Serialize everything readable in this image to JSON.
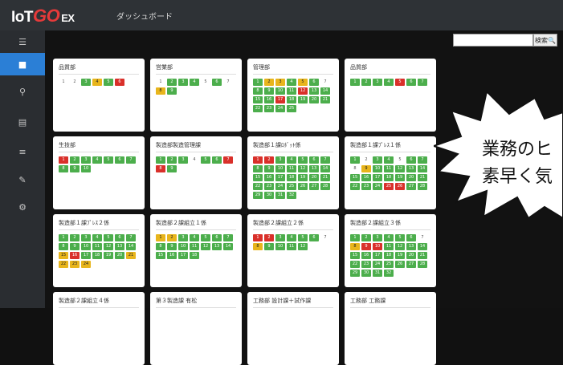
{
  "header": {
    "logo_main": "IoT",
    "logo_go": "GO",
    "logo_ex": "EX",
    "title": "ダッシュボード"
  },
  "sidebar": {
    "items": [
      {
        "icon": "menu-icon",
        "glyph": "☰"
      },
      {
        "icon": "dashboard-icon",
        "glyph": "■",
        "active": true
      },
      {
        "icon": "search-icon",
        "glyph": "⚲"
      },
      {
        "icon": "calendar-icon",
        "glyph": "▤"
      },
      {
        "icon": "list-icon",
        "glyph": "≡"
      },
      {
        "icon": "edit-icon",
        "glyph": "✎"
      },
      {
        "icon": "settings-icon",
        "glyph": "⚙"
      }
    ]
  },
  "search": {
    "value": "",
    "button_label": "検索🔍"
  },
  "colors": {
    "green": "#4cae4c",
    "yellow": "#e8b51c",
    "red": "#d9302a",
    "accent": "#2b7fd6"
  },
  "cards": [
    {
      "title": "品質部",
      "chips": [
        [
          "1",
          "w"
        ],
        [
          "2",
          "w"
        ],
        [
          "3",
          "g"
        ],
        [
          "4",
          "y"
        ],
        [
          "5",
          "g"
        ],
        [
          "6",
          "r"
        ]
      ]
    },
    {
      "title": "営業部",
      "chips": [
        [
          "1",
          "w"
        ],
        [
          "2",
          "g"
        ],
        [
          "3",
          "g"
        ],
        [
          "4",
          "g"
        ],
        [
          "5",
          "w"
        ],
        [
          "6",
          "g"
        ],
        [
          "7",
          "w"
        ],
        [
          "8",
          "y"
        ],
        [
          "9",
          "g"
        ]
      ]
    },
    {
      "title": "管理部",
      "chips": [
        [
          "1",
          "g"
        ],
        [
          "2",
          "y"
        ],
        [
          "3",
          "y"
        ],
        [
          "4",
          "g"
        ],
        [
          "5",
          "y"
        ],
        [
          "6",
          "g"
        ],
        [
          "7",
          "w"
        ],
        [
          "8",
          "g"
        ],
        [
          "9",
          "g"
        ],
        [
          "10",
          "g"
        ],
        [
          "11",
          "g"
        ],
        [
          "12",
          "r"
        ],
        [
          "13",
          "g"
        ],
        [
          "14",
          "g"
        ],
        [
          "15",
          "g"
        ],
        [
          "16",
          "g"
        ],
        [
          "17",
          "r"
        ],
        [
          "18",
          "g"
        ],
        [
          "19",
          "g"
        ],
        [
          "20",
          "g"
        ],
        [
          "21",
          "g"
        ],
        [
          "22",
          "g"
        ],
        [
          "23",
          "g"
        ],
        [
          "24",
          "g"
        ],
        [
          "25",
          "g"
        ]
      ]
    },
    {
      "title": "品質部",
      "chips": [
        [
          "1",
          "g"
        ],
        [
          "2",
          "g"
        ],
        [
          "3",
          "g"
        ],
        [
          "4",
          "g"
        ],
        [
          "5",
          "r"
        ],
        [
          "6",
          "g"
        ],
        [
          "7",
          "g"
        ]
      ]
    },
    {
      "title": "生技部",
      "chips": [
        [
          "1",
          "r"
        ],
        [
          "2",
          "g"
        ],
        [
          "3",
          "g"
        ],
        [
          "4",
          "g"
        ],
        [
          "5",
          "g"
        ],
        [
          "6",
          "g"
        ],
        [
          "7",
          "g"
        ],
        [
          "8",
          "g"
        ],
        [
          "9",
          "g"
        ],
        [
          "10",
          "g"
        ]
      ]
    },
    {
      "title": "製造部製造管理課",
      "chips": [
        [
          "1",
          "g"
        ],
        [
          "2",
          "g"
        ],
        [
          "3",
          "g"
        ],
        [
          "4",
          "w"
        ],
        [
          "5",
          "g"
        ],
        [
          "6",
          "g"
        ],
        [
          "7",
          "r"
        ],
        [
          "8",
          "r"
        ],
        [
          "9",
          "g"
        ]
      ]
    },
    {
      "title": "製造部１課ﾛﾎﾞｯﾄ係",
      "chips": [
        [
          "1",
          "r"
        ],
        [
          "2",
          "r"
        ],
        [
          "3",
          "g"
        ],
        [
          "4",
          "g"
        ],
        [
          "5",
          "g"
        ],
        [
          "6",
          "g"
        ],
        [
          "7",
          "g"
        ],
        [
          "8",
          "g"
        ],
        [
          "9",
          "g"
        ],
        [
          "10",
          "g"
        ],
        [
          "11",
          "g"
        ],
        [
          "12",
          "g"
        ],
        [
          "13",
          "g"
        ],
        [
          "14",
          "g"
        ],
        [
          "15",
          "g"
        ],
        [
          "16",
          "g"
        ],
        [
          "17",
          "g"
        ],
        [
          "18",
          "g"
        ],
        [
          "19",
          "g"
        ],
        [
          "20",
          "g"
        ],
        [
          "21",
          "g"
        ],
        [
          "22",
          "g"
        ],
        [
          "23",
          "g"
        ],
        [
          "24",
          "g"
        ],
        [
          "25",
          "g"
        ],
        [
          "26",
          "g"
        ],
        [
          "27",
          "g"
        ],
        [
          "28",
          "g"
        ],
        [
          "29",
          "g"
        ],
        [
          "30",
          "g"
        ],
        [
          "31",
          "g"
        ],
        [
          "32",
          "g"
        ]
      ]
    },
    {
      "title": "製造部１課ﾌﾟﾚｽ１係",
      "chips": [
        [
          "1",
          "g"
        ],
        [
          "2",
          "w"
        ],
        [
          "3",
          "g"
        ],
        [
          "4",
          "g"
        ],
        [
          "5",
          "w"
        ],
        [
          "6",
          "g"
        ],
        [
          "7",
          "g"
        ],
        [
          "8",
          "w"
        ],
        [
          "9",
          "y"
        ],
        [
          "10",
          "g"
        ],
        [
          "11",
          "g"
        ],
        [
          "12",
          "g"
        ],
        [
          "13",
          "g"
        ],
        [
          "14",
          "g"
        ],
        [
          "15",
          "g"
        ],
        [
          "16",
          "g"
        ],
        [
          "17",
          "g"
        ],
        [
          "18",
          "g"
        ],
        [
          "19",
          "g"
        ],
        [
          "20",
          "g"
        ],
        [
          "21",
          "g"
        ],
        [
          "22",
          "g"
        ],
        [
          "23",
          "g"
        ],
        [
          "24",
          "g"
        ],
        [
          "25",
          "r"
        ],
        [
          "26",
          "r"
        ],
        [
          "27",
          "g"
        ],
        [
          "28",
          "g"
        ]
      ]
    },
    {
      "title": "製造部１課ﾌﾟﾚｽ２係",
      "chips": [
        [
          "1",
          "g"
        ],
        [
          "2",
          "g"
        ],
        [
          "3",
          "g"
        ],
        [
          "4",
          "g"
        ],
        [
          "5",
          "g"
        ],
        [
          "6",
          "g"
        ],
        [
          "7",
          "g"
        ],
        [
          "8",
          "g"
        ],
        [
          "9",
          "g"
        ],
        [
          "10",
          "g"
        ],
        [
          "11",
          "g"
        ],
        [
          "12",
          "g"
        ],
        [
          "13",
          "g"
        ],
        [
          "14",
          "g"
        ],
        [
          "15",
          "y"
        ],
        [
          "16",
          "r"
        ],
        [
          "17",
          "g"
        ],
        [
          "18",
          "g"
        ],
        [
          "19",
          "g"
        ],
        [
          "20",
          "g"
        ],
        [
          "21",
          "y"
        ],
        [
          "22",
          "y"
        ],
        [
          "23",
          "y"
        ],
        [
          "24",
          "y"
        ]
      ]
    },
    {
      "title": "製造部２課組立１係",
      "chips": [
        [
          "1",
          "y"
        ],
        [
          "2",
          "y"
        ],
        [
          "3",
          "g"
        ],
        [
          "4",
          "g"
        ],
        [
          "5",
          "g"
        ],
        [
          "6",
          "g"
        ],
        [
          "7",
          "g"
        ],
        [
          "8",
          "g"
        ],
        [
          "9",
          "g"
        ],
        [
          "10",
          "g"
        ],
        [
          "11",
          "g"
        ],
        [
          "12",
          "g"
        ],
        [
          "13",
          "g"
        ],
        [
          "14",
          "g"
        ],
        [
          "15",
          "g"
        ],
        [
          "16",
          "g"
        ],
        [
          "17",
          "g"
        ],
        [
          "18",
          "g"
        ]
      ]
    },
    {
      "title": "製造部２課組立２係",
      "chips": [
        [
          "1",
          "r"
        ],
        [
          "2",
          "r"
        ],
        [
          "3",
          "g"
        ],
        [
          "4",
          "g"
        ],
        [
          "5",
          "g"
        ],
        [
          "6",
          "g"
        ],
        [
          "7",
          "w"
        ],
        [
          "8",
          "y"
        ],
        [
          "9",
          "g"
        ],
        [
          "10",
          "g"
        ],
        [
          "11",
          "g"
        ],
        [
          "12",
          "g"
        ]
      ]
    },
    {
      "title": "製造部２課組立３係",
      "chips": [
        [
          "1",
          "g"
        ],
        [
          "2",
          "g"
        ],
        [
          "3",
          "g"
        ],
        [
          "4",
          "g"
        ],
        [
          "5",
          "g"
        ],
        [
          "6",
          "g"
        ],
        [
          "7",
          "w"
        ],
        [
          "8",
          "y"
        ],
        [
          "9",
          "r"
        ],
        [
          "10",
          "r"
        ],
        [
          "11",
          "g"
        ],
        [
          "12",
          "g"
        ],
        [
          "13",
          "g"
        ],
        [
          "14",
          "g"
        ],
        [
          "15",
          "g"
        ],
        [
          "16",
          "g"
        ],
        [
          "17",
          "g"
        ],
        [
          "18",
          "g"
        ],
        [
          "19",
          "g"
        ],
        [
          "20",
          "g"
        ],
        [
          "21",
          "g"
        ],
        [
          "22",
          "g"
        ],
        [
          "23",
          "g"
        ],
        [
          "24",
          "g"
        ],
        [
          "25",
          "g"
        ],
        [
          "26",
          "g"
        ],
        [
          "27",
          "g"
        ],
        [
          "28",
          "g"
        ],
        [
          "29",
          "g"
        ],
        [
          "30",
          "g"
        ],
        [
          "31",
          "g"
        ],
        [
          "32",
          "g"
        ]
      ]
    },
    {
      "title": "製造部２課組立４係",
      "chips": []
    },
    {
      "title": "第３製造課 有松",
      "chips": []
    },
    {
      "title": "工務部 設計課＋試作課",
      "chips": []
    },
    {
      "title": "工務部 工務課",
      "chips": []
    }
  ],
  "callout": {
    "line1": "業務のヒ",
    "line2": "素早く気"
  }
}
